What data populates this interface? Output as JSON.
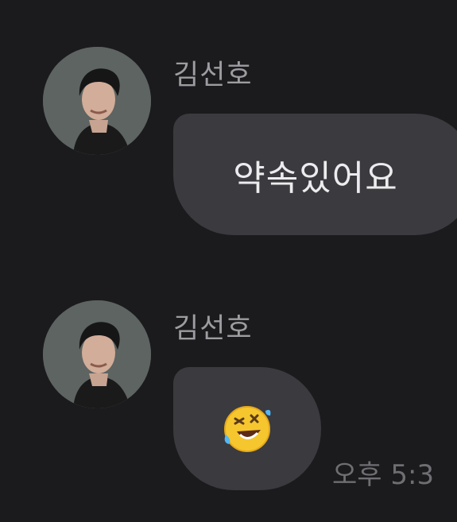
{
  "messages": [
    {
      "sender": "김선호",
      "text": ""
    },
    {
      "sender": "김선호",
      "emoji": "rolling-on-floor-laughing-emoji",
      "timestamp": "오후 5:3"
    }
  ],
  "bubble_text_1": "약속있어요",
  "colors": {
    "background": "#1b1b1d",
    "bubble": "#3a3a3f",
    "sender_text": "#9c9ca1",
    "message_text": "#ececee",
    "timestamp_text": "#6e6e73"
  }
}
